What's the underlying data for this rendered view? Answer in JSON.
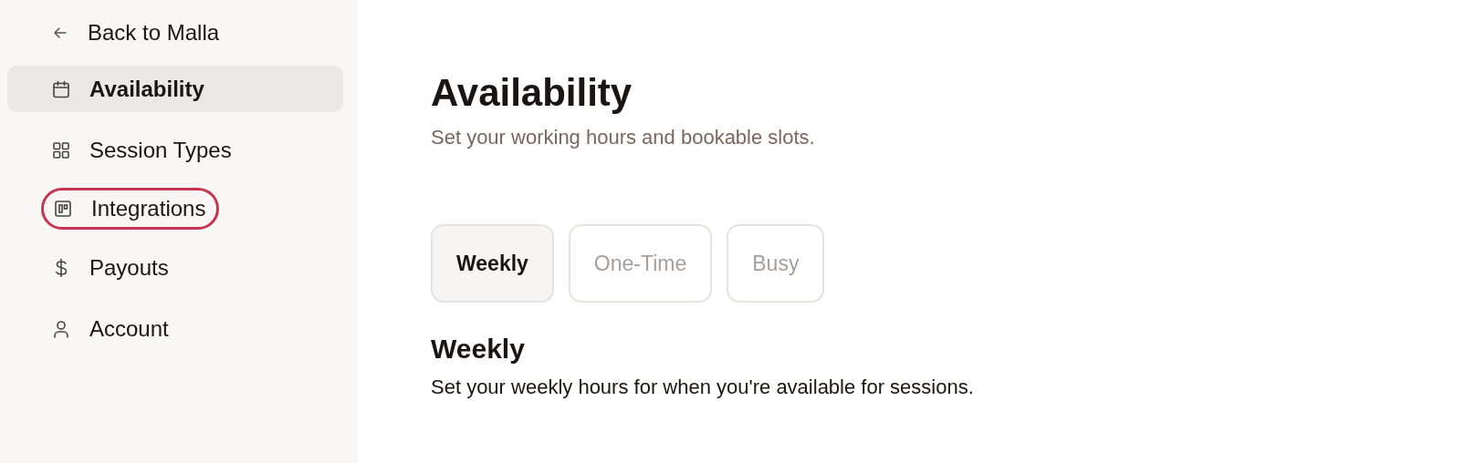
{
  "sidebar": {
    "back_link": "Back to Malla",
    "items": [
      {
        "kind": "calendar",
        "label": "Availability",
        "selected": true,
        "focused": false
      },
      {
        "kind": "grid",
        "label": "Session Types",
        "selected": false,
        "focused": false
      },
      {
        "kind": "board",
        "label": "Integrations",
        "selected": false,
        "focused": true
      },
      {
        "kind": "dollar",
        "label": "Payouts",
        "selected": false,
        "focused": false
      },
      {
        "kind": "person",
        "label": "Account",
        "selected": false,
        "focused": false
      }
    ]
  },
  "page": {
    "title": "Availability",
    "subtitle": "Set your working hours and bookable slots.",
    "tabs": [
      {
        "label": "Weekly",
        "selected": true
      },
      {
        "label": "One-Time",
        "selected": false
      },
      {
        "label": "Busy",
        "selected": false
      }
    ],
    "section": {
      "title": "Weekly",
      "description": "Set your weekly hours for when you're available for sessions."
    }
  }
}
